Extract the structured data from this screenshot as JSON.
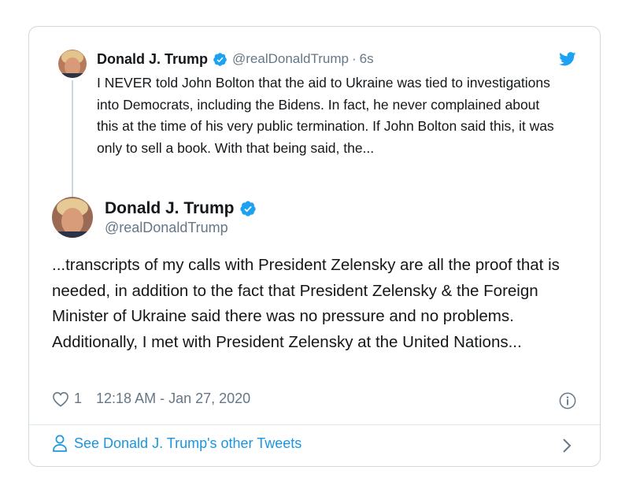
{
  "parent_tweet": {
    "name": "Donald J. Trump",
    "handle": "@realDonaldTrump",
    "separator": "·",
    "time": "6s",
    "text": "I NEVER told John Bolton that the aid to Ukraine was tied to investigations into Democrats, including the Bidens. In fact, he never complained about this at the time of his very public termination. If John Bolton said this, it was only to sell a book. With that being said, the..."
  },
  "main_tweet": {
    "name": "Donald J. Trump",
    "handle": "@realDonaldTrump",
    "text": "...transcripts of my calls with President Zelensky are all the proof that is needed, in addition to the fact that President Zelensky & the Foreign Minister of Ukraine said there was no pressure and no problems. Additionally, I met with President Zelensky at the United Nations...",
    "like_count": "1",
    "timestamp": "12:18 AM - Jan 27, 2020"
  },
  "footer": {
    "link_label": "See Donald J. Trump's other Tweets"
  },
  "icons": {
    "verified": "verified-badge-icon",
    "brand": "twitter-bird-icon",
    "like": "heart-icon",
    "info": "info-icon",
    "profile": "person-icon",
    "chevron": "chevron-right-icon"
  },
  "colors": {
    "accent": "#1da1f2",
    "link": "#1b95e0",
    "secondary_text": "#657786",
    "border": "#cfd9de"
  }
}
